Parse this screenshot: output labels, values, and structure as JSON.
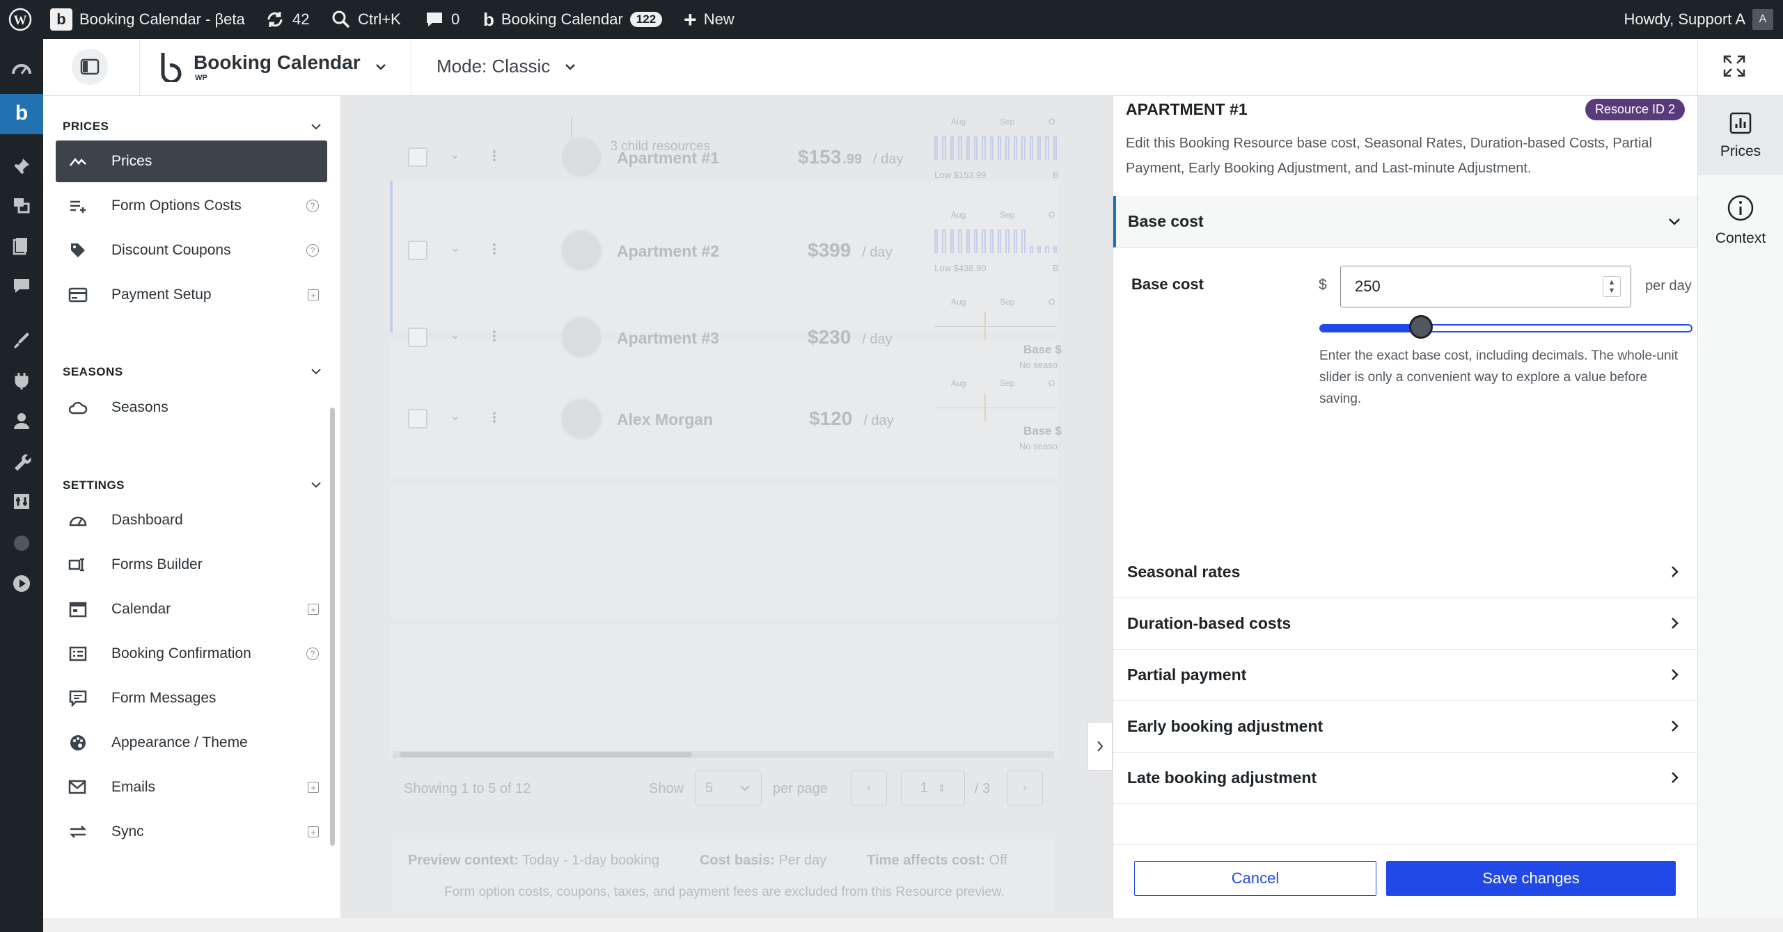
{
  "admin_bar": {
    "site_title": "Booking Calendar - βeta",
    "updates_count": "42",
    "search_shortcut": "Ctrl+K",
    "comments_count": "0",
    "plugin_label": "Booking Calendar",
    "plugin_badge": "122",
    "new_label": "New",
    "greeting": "Howdy, Support A"
  },
  "plugin_header": {
    "brand": "Booking Calendar",
    "brand_sub": "WP",
    "mode_label": "Mode: Classic"
  },
  "left_nav": {
    "sections": [
      {
        "title": "PRICES",
        "items": [
          {
            "label": "Prices",
            "icon": "prices-icon",
            "active": true
          },
          {
            "label": "Form Options Costs",
            "icon": "form-options-costs-icon",
            "badge": "?"
          },
          {
            "label": "Discount Coupons",
            "icon": "tag-icon",
            "badge": "?"
          },
          {
            "label": "Payment Setup",
            "icon": "card-icon",
            "badge": "+"
          }
        ]
      },
      {
        "title": "SEASONS",
        "items": [
          {
            "label": "Seasons",
            "icon": "cloud-icon"
          }
        ]
      },
      {
        "title": "SETTINGS",
        "items": [
          {
            "label": "Dashboard",
            "icon": "gauge-icon"
          },
          {
            "label": "Forms Builder",
            "icon": "forms-builder-icon"
          },
          {
            "label": "Calendar",
            "icon": "calendar-icon",
            "badge": "+"
          },
          {
            "label": "Booking Confirmation",
            "icon": "confirmation-icon",
            "badge": "?"
          },
          {
            "label": "Form Messages",
            "icon": "messages-icon"
          },
          {
            "label": "Appearance / Theme",
            "icon": "palette-icon"
          },
          {
            "label": "Emails",
            "icon": "email-icon",
            "badge": "+"
          },
          {
            "label": "Sync",
            "icon": "sync-icon",
            "badge": "+"
          }
        ]
      }
    ]
  },
  "resources_table": {
    "child_resources": "3 child resources",
    "rows": [
      {
        "name": "Apartment #1",
        "price": "$153",
        "cents": ".99",
        "unit": "/ day",
        "months": [
          "Aug",
          "Sep",
          "O"
        ],
        "low": "Low $153.99",
        "extra": "B"
      },
      {
        "name": "Apartment #2",
        "price": "$399",
        "cents": "",
        "unit": "/ day",
        "months": [
          "Aug",
          "Sep",
          "O"
        ],
        "low": "Low $438.90",
        "extra": "B"
      },
      {
        "name": "Apartment #3",
        "price": "$230",
        "cents": "",
        "unit": "/ day",
        "months": [
          "Aug",
          "Sep",
          "O"
        ],
        "base": "Base $",
        "noseason": "No seaso"
      },
      {
        "name": "Alex Morgan",
        "price": "$120",
        "cents": "",
        "unit": "/ day",
        "months": [
          "Aug",
          "Sep",
          "O"
        ],
        "base": "Base $",
        "noseason": "No seaso"
      }
    ],
    "showing": "Showing 1 to 5 of 12",
    "show_label": "Show",
    "per_page_value": "5",
    "per_page_label": "per page",
    "page_value": "1",
    "page_total": "/ 3",
    "preview_context_label": "Preview context:",
    "preview_context_value": "Today - 1-day booking",
    "cost_basis_label": "Cost basis:",
    "cost_basis_value": "Per day",
    "time_affects_label": "Time affects cost:",
    "time_affects_value": "Off",
    "footnote": "Form option costs, coupons, taxes, and payment fees are excluded from this Resource preview."
  },
  "panel": {
    "title": "APARTMENT #1",
    "resource_badge": "Resource ID 2",
    "description": "Edit this Booking Resource base cost, Seasonal Rates, Duration-based Costs, Partial Payment, Early Booking Adjustment, and Last-minute Adjustment.",
    "base_cost_section": "Base cost",
    "base_cost_label": "Base cost",
    "currency": "$",
    "base_cost_value": "250",
    "per_day": "per day",
    "slider_value": 0.27,
    "help_text": "Enter the exact base cost, including decimals. The whole-unit slider is only a convenient way to explore a value before saving.",
    "accordions": [
      "Seasonal rates",
      "Duration-based costs",
      "Partial payment",
      "Early booking adjustment",
      "Late booking adjustment"
    ],
    "cancel_label": "Cancel",
    "save_label": "Save changes"
  },
  "right_rail": {
    "prices_label": "Prices",
    "context_label": "Context"
  },
  "colors": {
    "accent": "#2149e8",
    "badge": "#5b3a7a",
    "admin_bar": "#1d2327",
    "active_nav": "#3c434a"
  }
}
